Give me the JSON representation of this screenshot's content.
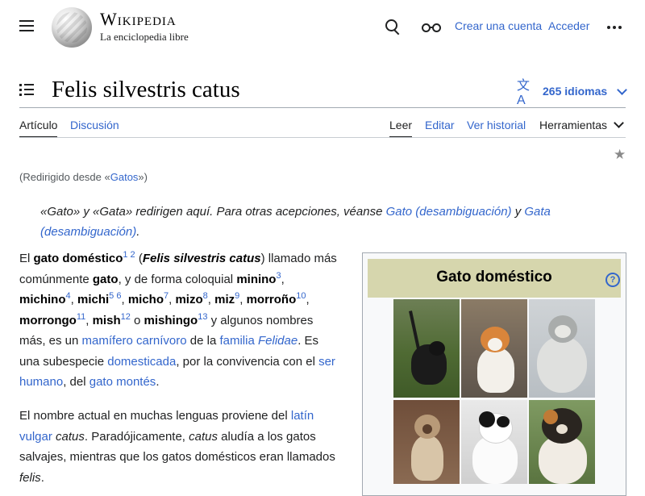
{
  "header": {
    "logo_word": "Wikipedia",
    "logo_tagline": "La enciclopedia libre",
    "icons": [
      "menu-icon",
      "search-icon",
      "glasses-icon",
      "more-icon"
    ],
    "create_account": "Crear una cuenta",
    "login": "Acceder"
  },
  "title": {
    "text": "Felis silvestris catus",
    "languages": "265 idiomas"
  },
  "tabs": {
    "article": "Artículo",
    "discussion": "Discusión",
    "read": "Leer",
    "edit": "Editar",
    "history": "Ver historial",
    "tools": "Herramientas"
  },
  "redirect": {
    "prefix": "(Redirigido desde «",
    "link": "Gatos",
    "suffix": "»)"
  },
  "hatnote": {
    "part1": "«Gato»  y «Gata» redirigen aquí. Para otras acepciones, véanse ",
    "link1": "Gato (desambiguación)",
    "mid": " y ",
    "link2": "Gata (desambiguación)",
    "end": "."
  },
  "para1": {
    "t1": "El ",
    "b1": "gato doméstico",
    "s1": "1 2",
    "t2": "  (",
    "bi1": "Felis silvestris catus",
    "t3": ") llamado más comúnmente ",
    "b2": "gato",
    "t4": ", y de forma coloquial ",
    "b3": "minino",
    "s2": "3",
    "b4": "michino",
    "s3": "4",
    "b5": "michi",
    "s4": "5 6",
    "b6": "micho",
    "s5": "7",
    "b7": "mizo",
    "s6": "8",
    "b8": "miz",
    "s7": "9",
    "b9": "morroño",
    "s8": "10",
    "b10": "morrongo",
    "s9": "11",
    "b11": "mish",
    "s10": "12",
    "t5": " o ",
    "b12": "mishingo",
    "s11": "13",
    "t6": "  y algunos nombres más, es un ",
    "l1": "mamífero carnívoro",
    "t7": " de la ",
    "l2": "familia ",
    "l2i": "Felidae",
    "t8": ". Es una subespecie ",
    "l3": "domesticada",
    "t9": ", por la convivencia con el ",
    "l4": "ser humano",
    "t10": ", del ",
    "l5": "gato montés",
    "t11": "."
  },
  "para2": {
    "t1": "El nombre actual en muchas lenguas proviene del ",
    "l1": "latín vulgar",
    "t2": " ",
    "i1": "catus",
    "t3": ". Paradójicamente, ",
    "i2": "catus",
    "t4": " aludía a los gatos salvajes, mientras que los gatos domésticos eran llamados ",
    "i3": "felis",
    "t5": "."
  },
  "infobox": {
    "title": "Gato doméstico",
    "help_glyph": "?"
  },
  "colors": {
    "link": "#3366cc",
    "infobox_header": "#d6d6ad",
    "rule": "#a2a9b1"
  }
}
